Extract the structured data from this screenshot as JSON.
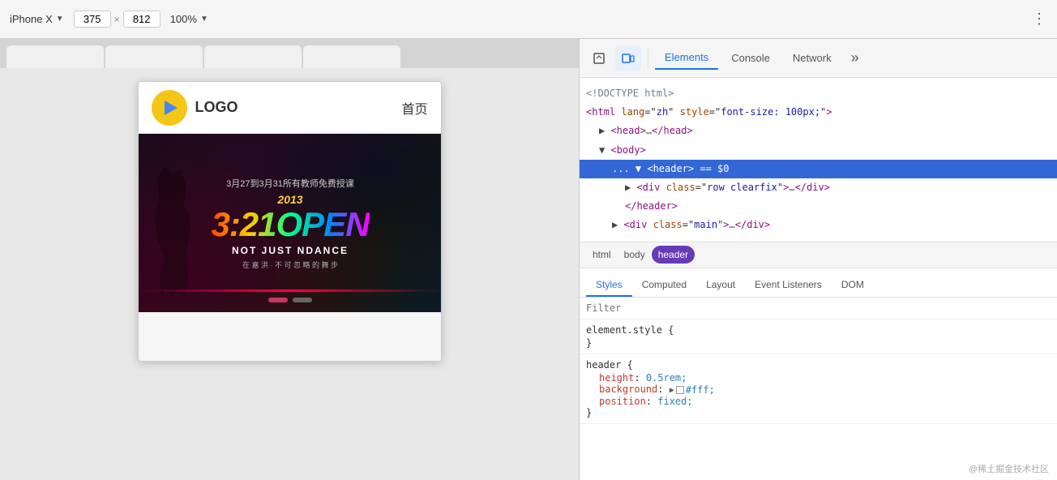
{
  "toolbar": {
    "device": "iPhone X",
    "chevron": "▼",
    "width": "375",
    "x_sep": "×",
    "height": "812",
    "zoom": "100%",
    "zoom_chevron": "▼",
    "dots": "⋮"
  },
  "browser_tabs": [
    {
      "label": "",
      "active": false
    },
    {
      "label": "",
      "active": false
    },
    {
      "label": "",
      "active": false
    },
    {
      "label": "",
      "active": false
    }
  ],
  "phone": {
    "logo_text": "LOGO",
    "nav_text": "首页",
    "banner_date": "3月27到3月31所有教师免费授课",
    "banner_title": "3:21OPEN",
    "banner_subtitle": "NOT JUST NDANCE",
    "banner_sub2": "在 嘉 洪 · 不 可 忽 略 的 舞 步",
    "year_label": "2013"
  },
  "devtools": {
    "tabs": [
      {
        "label": "Elements",
        "active": true
      },
      {
        "label": "Console",
        "active": false
      },
      {
        "label": "Network",
        "active": false
      }
    ],
    "more_icon": "»",
    "cursor_icon": "⬡",
    "device_icon": "▣",
    "dom": {
      "lines": [
        {
          "indent": 0,
          "content": "<!DOCTYPE html>",
          "type": "comment"
        },
        {
          "indent": 0,
          "content": "<html lang=\"zh\" style=\"font-size: 100px;\">",
          "type": "open"
        },
        {
          "indent": 1,
          "content": "▶ <head>…</head>",
          "type": "collapsed"
        },
        {
          "indent": 1,
          "content": "▼ <body>",
          "type": "open"
        },
        {
          "indent": 2,
          "content": "... ▼ <header> == $0",
          "type": "selected"
        },
        {
          "indent": 3,
          "content": "▶ <div class=\"row clearfix\">…</div>",
          "type": "collapsed"
        },
        {
          "indent": 3,
          "content": "</header>",
          "type": "close"
        },
        {
          "indent": 2,
          "content": "▶ <div class=\"main\">…</div>",
          "type": "collapsed"
        }
      ]
    },
    "breadcrumbs": [
      {
        "label": "html",
        "active": false
      },
      {
        "label": "body",
        "active": false
      },
      {
        "label": "header",
        "active": true
      }
    ],
    "inner_tabs": [
      {
        "label": "Styles",
        "active": true
      },
      {
        "label": "Computed",
        "active": false
      },
      {
        "label": "Layout",
        "active": false
      },
      {
        "label": "Event Listeners",
        "active": false
      },
      {
        "label": "DOM",
        "active": false
      }
    ],
    "filter_placeholder": "Filter",
    "css_blocks": [
      {
        "selector": "element.style {",
        "closing": "}",
        "props": []
      },
      {
        "selector": "header {",
        "closing": "}",
        "props": [
          {
            "name": "height",
            "value": "0.5rem;"
          },
          {
            "name": "background",
            "value": "#fff;",
            "has_arrow": true,
            "has_swatch": true,
            "swatch_color": "#fff"
          },
          {
            "name": "position",
            "value": "fixed;"
          }
        ]
      }
    ],
    "watermark": "@稀土掘金技术社区"
  }
}
